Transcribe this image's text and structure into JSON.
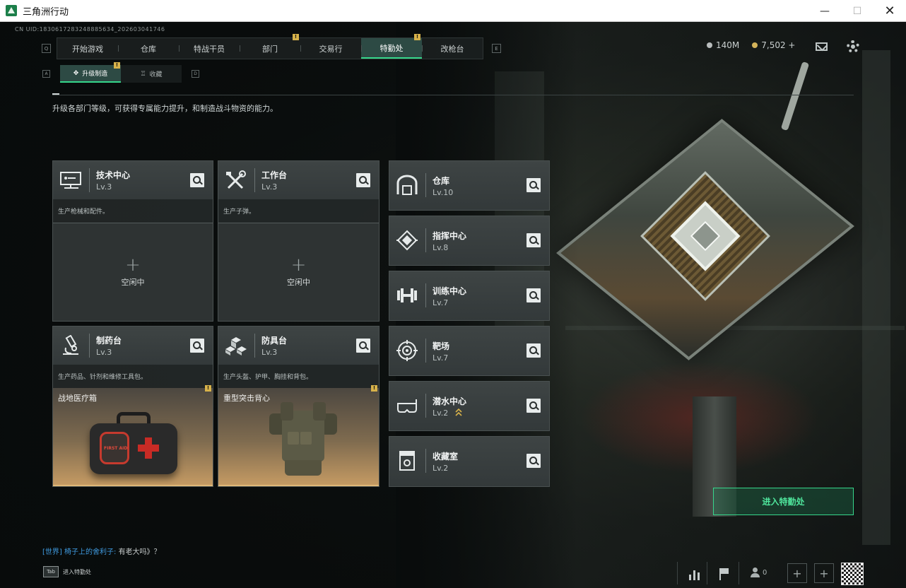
{
  "window": {
    "title": "三角洲行动",
    "minimize": "—",
    "maximize": "☐",
    "close": "✕"
  },
  "uid": "CN UID:1830617283248885634_202603041746",
  "nav": {
    "left_key": "Q",
    "right_key": "E",
    "tabs": [
      {
        "label": "开始游戏",
        "active": false
      },
      {
        "label": "仓库",
        "active": false
      },
      {
        "label": "特战干员",
        "active": false
      },
      {
        "label": "部门",
        "active": false,
        "badge": "!"
      },
      {
        "label": "交易行",
        "active": false
      },
      {
        "label": "特勤处",
        "active": true,
        "badge": "!"
      },
      {
        "label": "改枪台",
        "active": false
      }
    ]
  },
  "resources": {
    "silver": "140M",
    "gold": "7,502 +",
    "silver_color": "#b9bdbd",
    "gold_color": "#d3b35a"
  },
  "subnav": {
    "left_key": "A",
    "right_key": "D",
    "tabs": [
      {
        "label": "升级制造",
        "active": true,
        "badge": "!"
      },
      {
        "label": "收藏",
        "active": false
      }
    ]
  },
  "description": "升级各部门等级，可获得专属能力提升，和制造战斗物资的能力。",
  "production_cards": [
    {
      "name": "技术中心",
      "level": "Lv.3",
      "subtitle": "生产枪械和配件。",
      "icon": "computer-icon",
      "status": "空闲中"
    },
    {
      "name": "工作台",
      "level": "Lv.3",
      "subtitle": "生产子弹。",
      "icon": "tools-icon",
      "status": "空闲中"
    },
    {
      "name": "制药台",
      "level": "Lv.3",
      "subtitle": "生产药品、针剂和维修工具包。",
      "icon": "microscope-icon",
      "product": "战地医疗箱",
      "product_label": "FIRST AID",
      "badge": "!"
    },
    {
      "name": "防具台",
      "level": "Lv.3",
      "subtitle": "生产头盔、护甲、胸挂和背包。",
      "icon": "armor-cubes-icon",
      "product": "重型突击背心",
      "badge": "!"
    }
  ],
  "facility_cards": [
    {
      "name": "仓库",
      "level": "Lv.10",
      "icon": "warehouse-icon"
    },
    {
      "name": "指挥中心",
      "level": "Lv.8",
      "icon": "command-chip-icon"
    },
    {
      "name": "训练中心",
      "level": "Lv.7",
      "icon": "dumbbell-icon"
    },
    {
      "name": "靶场",
      "level": "Lv.7",
      "icon": "target-icon"
    },
    {
      "name": "潜水中心",
      "level": "Lv.2",
      "icon": "diving-mask-icon",
      "upgrade": "upgrade-arrows-icon"
    },
    {
      "name": "收藏室",
      "level": "Lv.2",
      "icon": "trophy-icon"
    }
  ],
  "enter_button": "进入特勤处",
  "chat": {
    "channel": "[世界]",
    "user": "椅子上的舍利子:",
    "message": "有老大吗》？"
  },
  "tab_hint": {
    "key": "Tab",
    "label": "进入特勤处"
  },
  "friends_count": "0",
  "accent_color": "#36d78b"
}
